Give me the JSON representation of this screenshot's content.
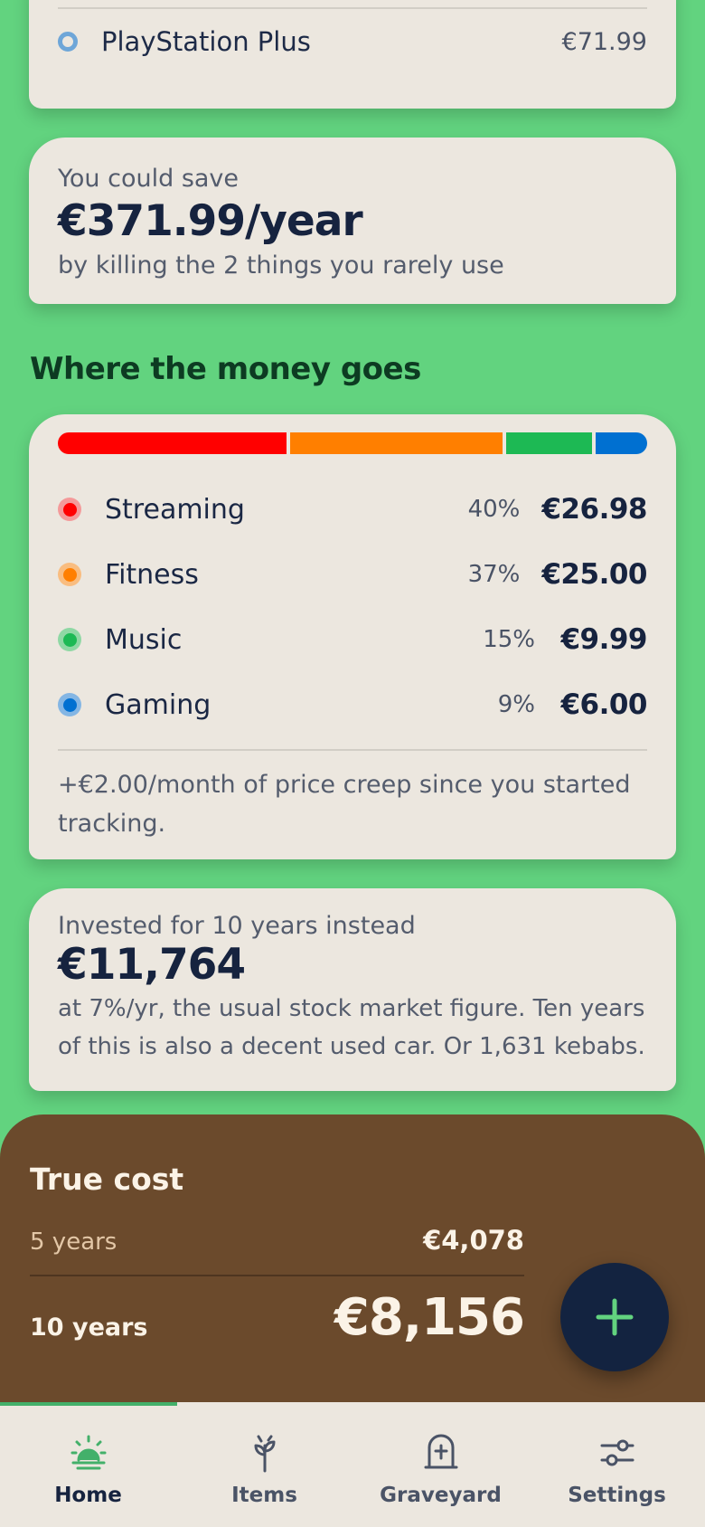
{
  "top_subscription": {
    "name": "PlayStation Plus",
    "price": "€71.99",
    "dot_color": "#6ea6d8"
  },
  "savings": {
    "intro": "You could save",
    "amount": "€371.99/year",
    "note": "by killing the 2 things you rarely use"
  },
  "breakdown": {
    "heading": "Where the money goes",
    "categories": [
      {
        "name": "Streaming",
        "percent": "40%",
        "amount": "€26.98",
        "share": 40,
        "color": "#ff0000",
        "ring": "#f49a9a"
      },
      {
        "name": "Fitness",
        "percent": "37%",
        "amount": "€25.00",
        "share": 37,
        "color": "#ff7f00",
        "ring": "#f9bd80"
      },
      {
        "name": "Music",
        "percent": "15%",
        "amount": "€9.99",
        "share": 15,
        "color": "#1db954",
        "ring": "#8fd8a4"
      },
      {
        "name": "Gaming",
        "percent": "9%",
        "amount": "€6.00",
        "share": 9,
        "color": "#0070d1",
        "ring": "#84b6e4"
      }
    ],
    "creep_note": "+€2.00/month of price creep since you started tracking."
  },
  "invest": {
    "intro": "Invested for 10 years instead",
    "amount": "€11,764",
    "note": "at 7%/yr, the usual stock market figure. Ten years of this is also a decent used car. Or 1,631 kebabs."
  },
  "true_cost": {
    "title": "True cost",
    "five_label": "5 years",
    "five_value": "€4,078",
    "ten_label": "10 years",
    "ten_value": "€8,156"
  },
  "fab": {
    "icon": "plus-icon",
    "color": "#62d37f"
  },
  "nav": {
    "items": [
      {
        "label": "Home",
        "icon": "sunrise-icon"
      },
      {
        "label": "Items",
        "icon": "sprout-icon"
      },
      {
        "label": "Graveyard",
        "icon": "tombstone-icon"
      },
      {
        "label": "Settings",
        "icon": "sliders-icon"
      }
    ],
    "active_color": "#43b06a"
  }
}
